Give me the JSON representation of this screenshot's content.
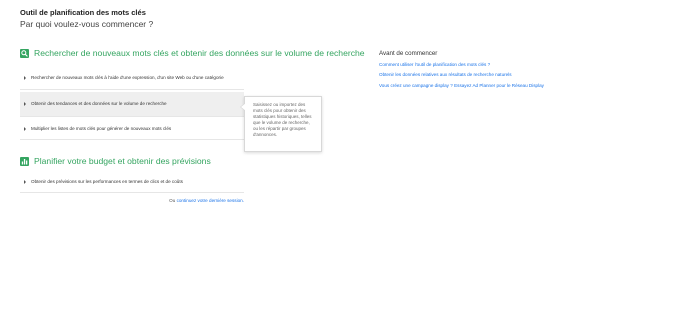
{
  "header": {
    "title": "Outil de planification des mots clés",
    "subtitle": "Par quoi voulez-vous commencer ?"
  },
  "sections": [
    {
      "title": "Rechercher de nouveaux mots clés et obtenir des données sur le volume de recherche",
      "icon": "search-icon",
      "options": [
        "Rechercher de nouveaux mots clés à l'aide d'une expression, d'un site Web ou d'une catégorie",
        "Obtenir des tendances et des données sur le volume de recherche",
        "Multiplier les listes de mots clés pour générer de nouveaux mots clés"
      ]
    },
    {
      "title": "Planifier votre budget et obtenir des prévisions",
      "icon": "bar-chart-icon",
      "options": [
        "Obtenir des prévisions sur les performances en termes de clics et de coûts"
      ]
    }
  ],
  "tooltip": "Saisissez ou importez des mots clés pour obtenir des statistiques historiques, telles que le volume de recherche, ou les répartir par groupes d'annonces.",
  "continue": {
    "prefix": "Ou ",
    "link": "continuez votre dernière session."
  },
  "sidebar": {
    "title": "Avant de commencer",
    "links": [
      "Comment utiliser l'outil de planification des mots clés ?",
      "Obtenir les données relatives aux résultats de recherche naturels",
      "Vous créez une campagne display ? Essayez Ad Planner pour le Réseau Display"
    ]
  },
  "colors": {
    "accent": "#35a561",
    "link": "#1a73e8"
  }
}
